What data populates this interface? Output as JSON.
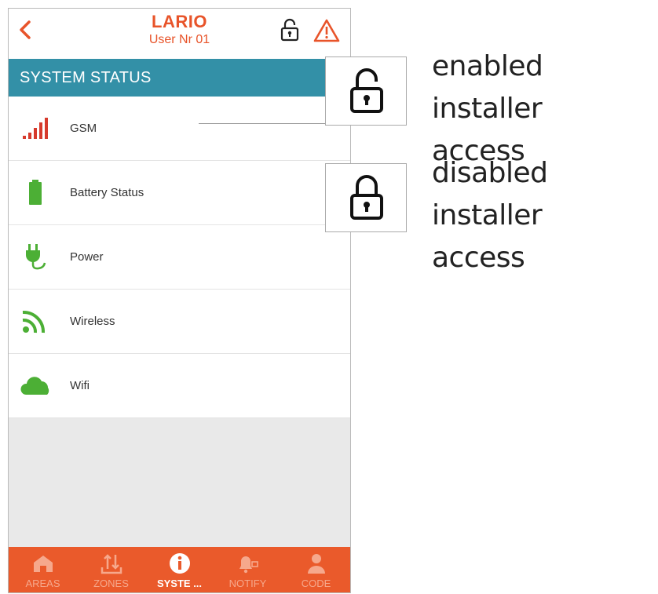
{
  "header": {
    "back_icon": "chevron-left-icon",
    "title": "LARIO",
    "subtitle": "User  Nr 01",
    "lock_icon": "lock-open-icon",
    "alert_icon": "warning-icon",
    "accent_color": "#e8542a"
  },
  "section": {
    "title": "SYSTEM STATUS",
    "bar_color": "#3390a7"
  },
  "status_items": [
    {
      "label": "GSM",
      "icon": "signal-bars-icon"
    },
    {
      "label": "Battery Status",
      "icon": "battery-icon"
    },
    {
      "label": "Power",
      "icon": "plug-icon"
    },
    {
      "label": "Wireless",
      "icon": "wireless-icon"
    },
    {
      "label": "Wifi",
      "icon": "cloud-icon"
    }
  ],
  "tabs": [
    {
      "label": "AREAS",
      "icon": "home-icon",
      "active": false
    },
    {
      "label": "ZONES",
      "icon": "zones-icon",
      "active": false
    },
    {
      "label": "SYSTE ...",
      "icon": "info-icon",
      "active": true
    },
    {
      "label": "NOTIFY",
      "icon": "notify-icon",
      "active": false
    },
    {
      "label": "CODE",
      "icon": "user-icon",
      "active": false
    }
  ],
  "callouts": [
    {
      "line1": "enabled installer",
      "line2": "access",
      "icon": "lock-open-icon"
    },
    {
      "line1": "disabled installer",
      "line2": "access",
      "icon": "lock-closed-icon"
    }
  ],
  "colors": {
    "tab_bar": "#ea5a2b",
    "signal_red": "#d63a2c",
    "status_green": "#4caf35"
  }
}
